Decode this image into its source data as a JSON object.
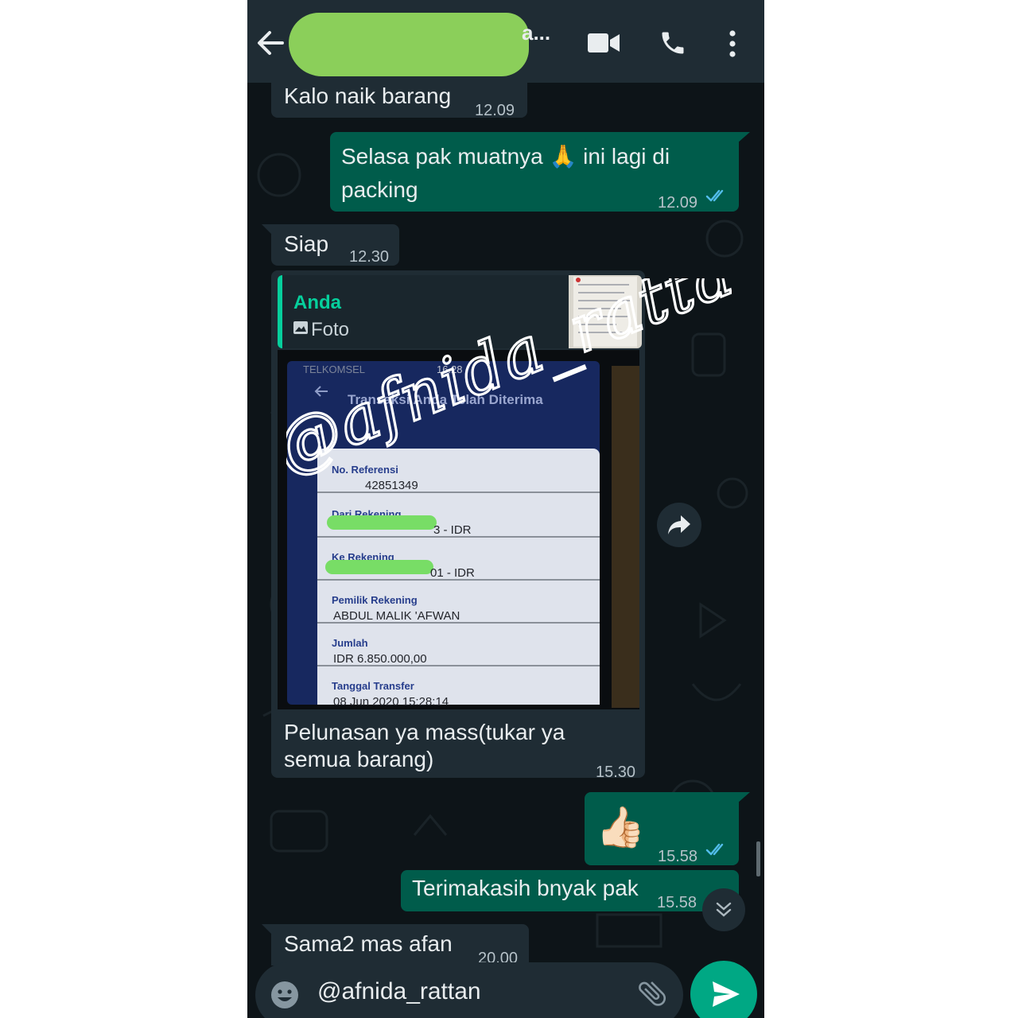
{
  "header": {
    "title_visible_suffix": "a...",
    "icons": [
      "back-arrow-icon",
      "video-call-icon",
      "phone-icon",
      "more-vert-icon"
    ]
  },
  "messages": [
    {
      "direction": "in",
      "text": "Kalo naik barang",
      "time": "12.09"
    },
    {
      "direction": "out",
      "text_line1": "Selasa pak muatnya 🙏 ini lagi di",
      "text_line2": "packing",
      "time": "12.09",
      "status": "read"
    },
    {
      "direction": "in",
      "text": "Siap",
      "time": "12.30"
    },
    {
      "direction": "in",
      "type": "image-reply",
      "reply": {
        "author": "Anda",
        "label": "Foto"
      },
      "caption_line1": "Pelunasan ya mass(tukar ya",
      "caption_line2": "semua barang)",
      "time": "15.30"
    },
    {
      "direction": "out",
      "text": "👍🏻",
      "time": "15.58",
      "status": "read"
    },
    {
      "direction": "out",
      "text": "Terimakasih bnyak pak",
      "time": "15.58"
    },
    {
      "direction": "in",
      "text": "Sama2 mas afan",
      "time": "20.00"
    }
  ],
  "photo": {
    "status_carrier": "TELKOMSEL",
    "status_time": "16.28",
    "screen_title": "Transaksi Anda Telah Diterima",
    "fields": [
      {
        "label": "No. Referensi",
        "value": "42851349"
      },
      {
        "label": "Dari Rekening",
        "value": "3 - IDR"
      },
      {
        "label": "Ke Rekening",
        "value": "01 - IDR"
      },
      {
        "label": "Pemilik Rekening",
        "value": "ABDUL MALIK 'AFWAN"
      },
      {
        "label": "Jumlah",
        "value": "IDR 6.850.000,00"
      },
      {
        "label": "Tanggal Transfer",
        "value": "08 Jun 2020 15:28:14"
      }
    ]
  },
  "watermark": "@afnida_rattan",
  "composer": {
    "value": "@afnida_rattan"
  },
  "colors": {
    "header": "#1f2c34",
    "incoming": "#1f2c34",
    "outgoing": "#005c4b",
    "accent": "#00a884",
    "read_tick": "#53bdeb"
  }
}
